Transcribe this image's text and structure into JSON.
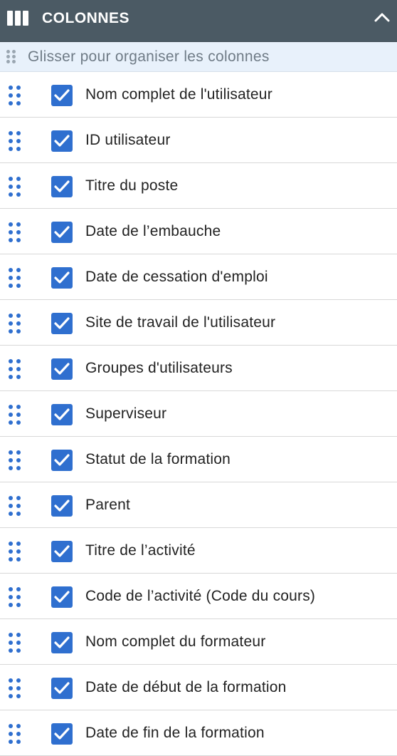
{
  "header": {
    "title": "COLONNES",
    "icon": "columns-icon",
    "collapse_icon": "chevron-up-icon",
    "background": "#4b5a64"
  },
  "hint": {
    "text": "Glisser pour organiser les colonnes",
    "icon": "drag-grip-icon"
  },
  "accent_color": "#2f6fcf",
  "columns": [
    {
      "label": "Nom complet de l'utilisateur",
      "checked": true
    },
    {
      "label": "ID utilisateur",
      "checked": true
    },
    {
      "label": "Titre du poste",
      "checked": true
    },
    {
      "label": "Date de l’embauche",
      "checked": true
    },
    {
      "label": "Date de cessation d'emploi",
      "checked": true
    },
    {
      "label": "Site de travail de l'utilisateur",
      "checked": true
    },
    {
      "label": "Groupes d'utilisateurs",
      "checked": true
    },
    {
      "label": "Superviseur",
      "checked": true
    },
    {
      "label": "Statut de la formation",
      "checked": true
    },
    {
      "label": "Parent",
      "checked": true
    },
    {
      "label": "Titre de l’activité",
      "checked": true
    },
    {
      "label": "Code de l’activité (Code du cours)",
      "checked": true
    },
    {
      "label": "Nom complet du formateur",
      "checked": true
    },
    {
      "label": "Date de début de la formation",
      "checked": true
    },
    {
      "label": "Date de fin de la formation",
      "checked": true
    }
  ]
}
